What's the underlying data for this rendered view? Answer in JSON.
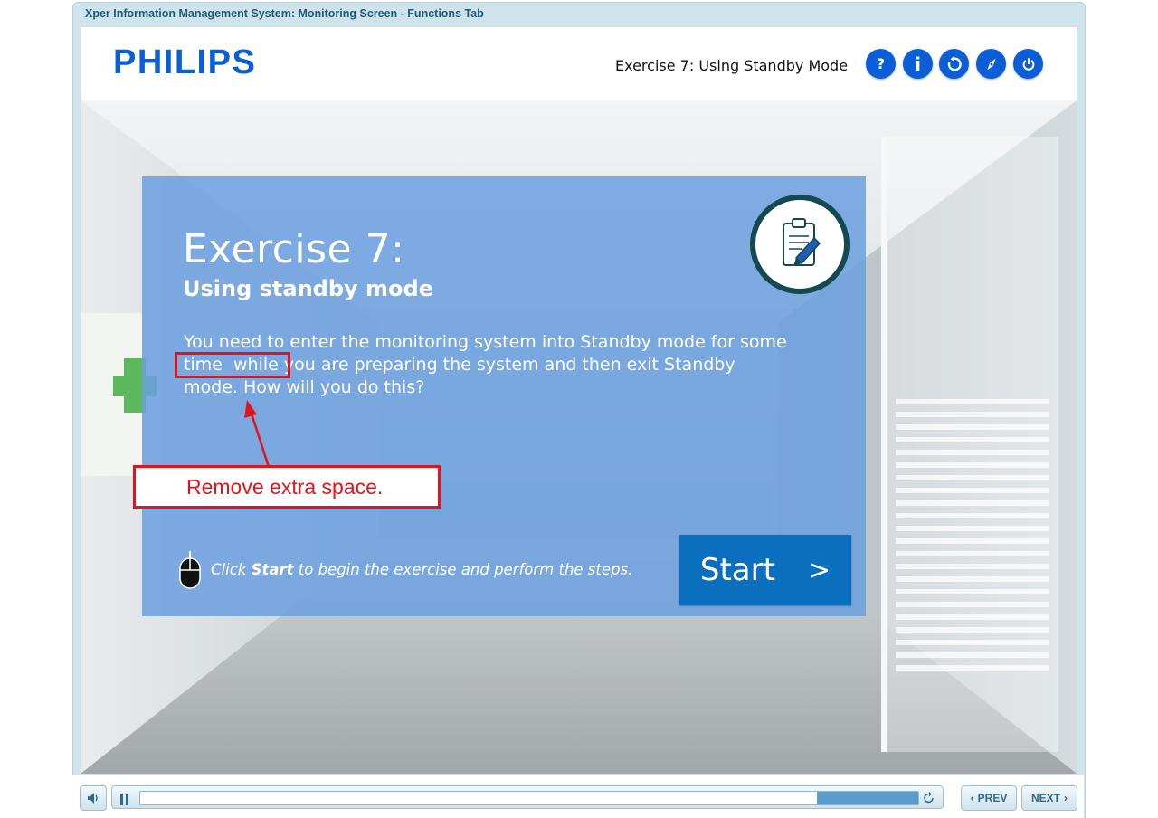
{
  "window": {
    "title": "Xper Information Management System: Monitoring Screen - Functions Tab"
  },
  "header": {
    "logo": "PHILIPS",
    "exercise_title": "Exercise 7: Using Standby Mode",
    "buttons": [
      {
        "label": "?",
        "icon": "help-icon"
      },
      {
        "label": "i",
        "icon": "info-icon"
      },
      {
        "label": "",
        "icon": "restart-icon"
      },
      {
        "label": "",
        "icon": "compass-icon"
      },
      {
        "label": "",
        "icon": "power-icon"
      }
    ]
  },
  "panel": {
    "title": "Exercise 7:",
    "subtitle": "Using standby mode",
    "body_line1": "You need to enter the monitoring system into Standby mode for some",
    "body_line2": "time  while you are preparing the system and then exit Standby",
    "body_line3": "mode. How will you do this?",
    "hint_prefix": "Click",
    "hint_bold": "Start",
    "hint_suffix": "to begin the exercise and perform the steps.",
    "start_label": "Start",
    "start_chevron": ">"
  },
  "annotation": {
    "callout_text": "Remove extra space.",
    "color": "#e2141b"
  },
  "controls": {
    "mute_icon": "speaker-icon",
    "pause_icon": "pause-icon",
    "progress": 0.87,
    "replay_icon": "replay-icon",
    "prev_label": "PREV",
    "next_label": "NEXT"
  },
  "colors": {
    "brand_blue": "#0b5ed7",
    "panel_blue": "#6ba0e0",
    "start_blue": "#0b6fc0"
  }
}
